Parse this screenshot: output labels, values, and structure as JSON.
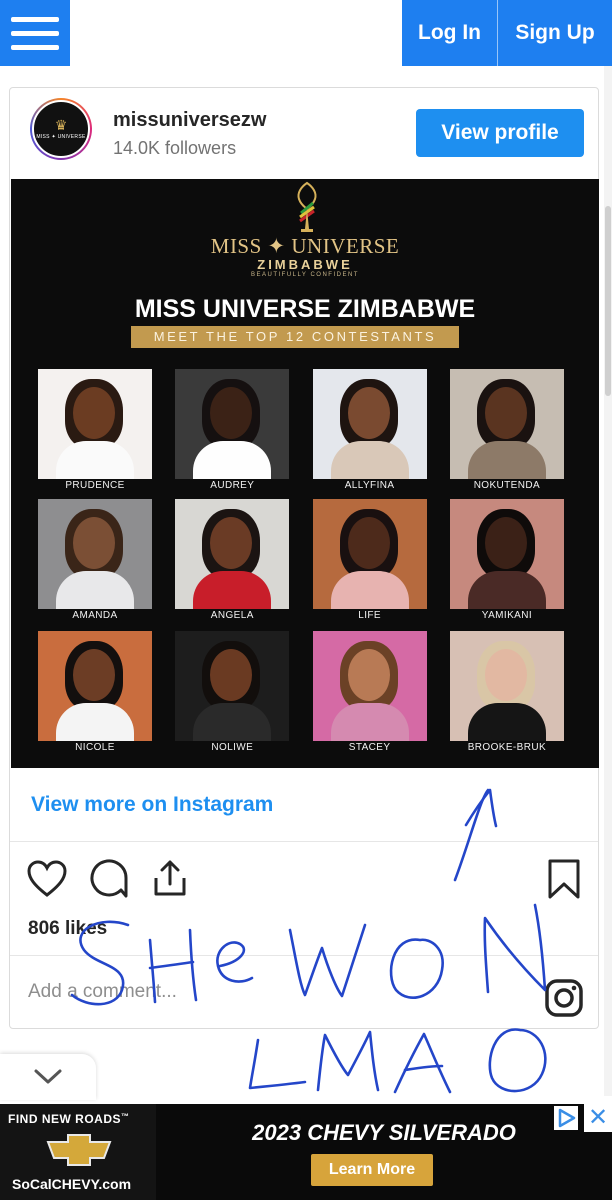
{
  "topbar": {
    "menu_icon": "hamburger-menu-icon",
    "login_label": "Log In",
    "signup_label": "Sign Up",
    "accent": "#1e7ff0"
  },
  "profile": {
    "username": "missuniversezw",
    "followers": "14.0K followers",
    "view_profile_label": "View profile",
    "avatar_icon": "miss-universe-crown-logo"
  },
  "post": {
    "logo_line1": "MISS ✦ UNIVERSE",
    "logo_line2": "ZIMBABWE",
    "logo_line3": "BEAUTIFULLY CONFIDENT",
    "title": "MISS UNIVERSE ZIMBABWE",
    "subtitle": "MEET THE TOP 12 CONTESTANTS",
    "contestants": [
      {
        "name": "PRUDENCE",
        "bg": "#f4f1ef",
        "skin": "#6b3c22",
        "hair": "#2a1a12",
        "outfit": "#fafafa"
      },
      {
        "name": "AUDREY",
        "bg": "#3a3a3a",
        "skin": "#3b2216",
        "hair": "#151010",
        "outfit": "#fefefe"
      },
      {
        "name": "ALLYFINA",
        "bg": "#e4e7ec",
        "skin": "#7a4a30",
        "hair": "#1e1410",
        "outfit": "#d9c8b8"
      },
      {
        "name": "NOKUTENDA",
        "bg": "#c6bdb2",
        "skin": "#5a3420",
        "hair": "#1a1210",
        "outfit": "#8d7a68"
      },
      {
        "name": "AMANDA",
        "bg": "#8e8e90",
        "skin": "#7b4f35",
        "hair": "#3a2518",
        "outfit": "#e8e8ea"
      },
      {
        "name": "ANGELA",
        "bg": "#d8d7d3",
        "skin": "#6a3b25",
        "hair": "#1b1412",
        "outfit": "#c81e2a"
      },
      {
        "name": "LIFE",
        "bg": "#b66a3e",
        "skin": "#4d2a1b",
        "hair": "#191010",
        "outfit": "#e7b3b0"
      },
      {
        "name": "YAMIKANI",
        "bg": "#c6897e",
        "skin": "#3b2117",
        "hair": "#0f0b0a",
        "outfit": "#4a2a26"
      },
      {
        "name": "NICOLE",
        "bg": "#c96d3e",
        "skin": "#6c3d25",
        "hair": "#130f0e",
        "outfit": "#f4f4f4"
      },
      {
        "name": "NOLIWE",
        "bg": "#1d1d1d",
        "skin": "#6a3a22",
        "hair": "#120e0c",
        "outfit": "#2a2a2a"
      },
      {
        "name": "STACEY",
        "bg": "#d56aa5",
        "skin": "#b87a55",
        "hair": "#6b4126",
        "outfit": "#d58ab0"
      },
      {
        "name": "BROOKE-BRUK",
        "bg": "#d7c0b4",
        "skin": "#e2b8a2",
        "hair": "#d9c6a6",
        "outfit": "#151515"
      }
    ]
  },
  "actions": {
    "view_more": "View more on Instagram",
    "like_icon": "heart-icon",
    "comment_icon": "comment-bubble-icon",
    "share_icon": "share-icon",
    "save_icon": "bookmark-icon",
    "likes": "806 likes",
    "comment_placeholder": "Add a comment...",
    "instagram_icon": "instagram-logo-icon"
  },
  "annotation": {
    "line1": "SHE WON",
    "line2": "LMAO",
    "color": "#2446c9"
  },
  "collapse": {
    "icon": "chevron-down-icon"
  },
  "ad": {
    "find": "FIND NEW ROADS",
    "trademark": "™",
    "site": "SoCalCHEVY.com",
    "headline": "2023 CHEVY SILVERADO",
    "cta": "Learn More",
    "adchoices_icon": "adchoices-icon",
    "close_label": "✕"
  }
}
